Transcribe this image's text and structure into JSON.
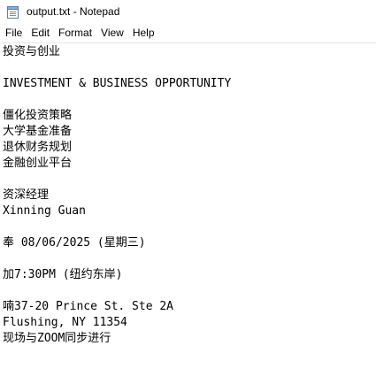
{
  "window": {
    "title": "output.txt - Notepad",
    "icon": "notepad-icon"
  },
  "menu": {
    "items": [
      "File",
      "Edit",
      "Format",
      "View",
      "Help"
    ]
  },
  "document": {
    "lines": [
      "投资与创业",
      "",
      "INVESTMENT & BUSINESS OPPORTUNITY",
      "",
      "僵化投资策略",
      "大学基金准备",
      "退休财务规划",
      "金融创业平台",
      "",
      "资深经理",
      "Xinning Guan",
      "",
      "奉 08/06/2025 (星期三)",
      "",
      "加7:30PM (纽约东岸)",
      "",
      "喃37-20 Prince St. Ste 2A",
      "Flushing, NY 11354",
      "现场与ZOOM同步进行"
    ]
  }
}
